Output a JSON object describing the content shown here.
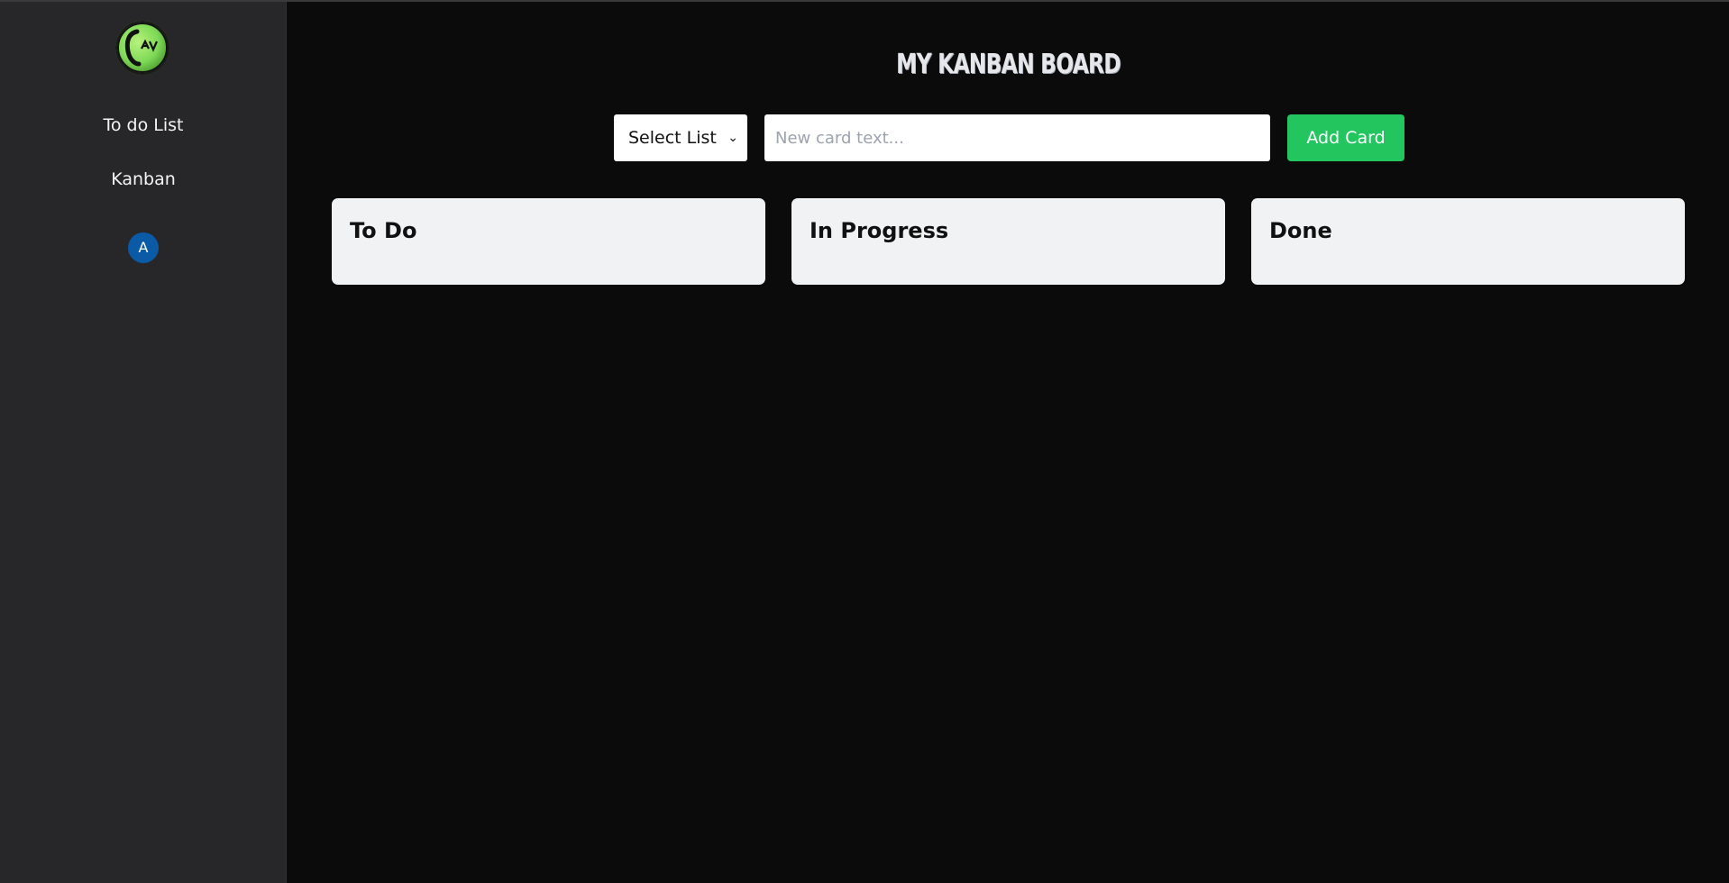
{
  "sidebar": {
    "logo_icon": "av-logo",
    "nav": [
      {
        "label": "To do List"
      },
      {
        "label": "Kanban"
      }
    ],
    "avatar_initial": "A"
  },
  "main": {
    "title": "MY KANBAN BOARD",
    "toolbar": {
      "select_label": "Select List",
      "input_value": "",
      "input_placeholder": "New card text...",
      "add_button_label": "Add Card"
    },
    "columns": [
      {
        "title": "To Do",
        "cards": []
      },
      {
        "title": "In Progress",
        "cards": []
      },
      {
        "title": "Done",
        "cards": []
      }
    ]
  },
  "colors": {
    "sidebar_bg": "#27272a",
    "main_bg": "#0b0b0b",
    "accent_green": "#22c55e",
    "avatar_blue": "#0b5aa6",
    "column_bg": "#f1f2f4"
  }
}
